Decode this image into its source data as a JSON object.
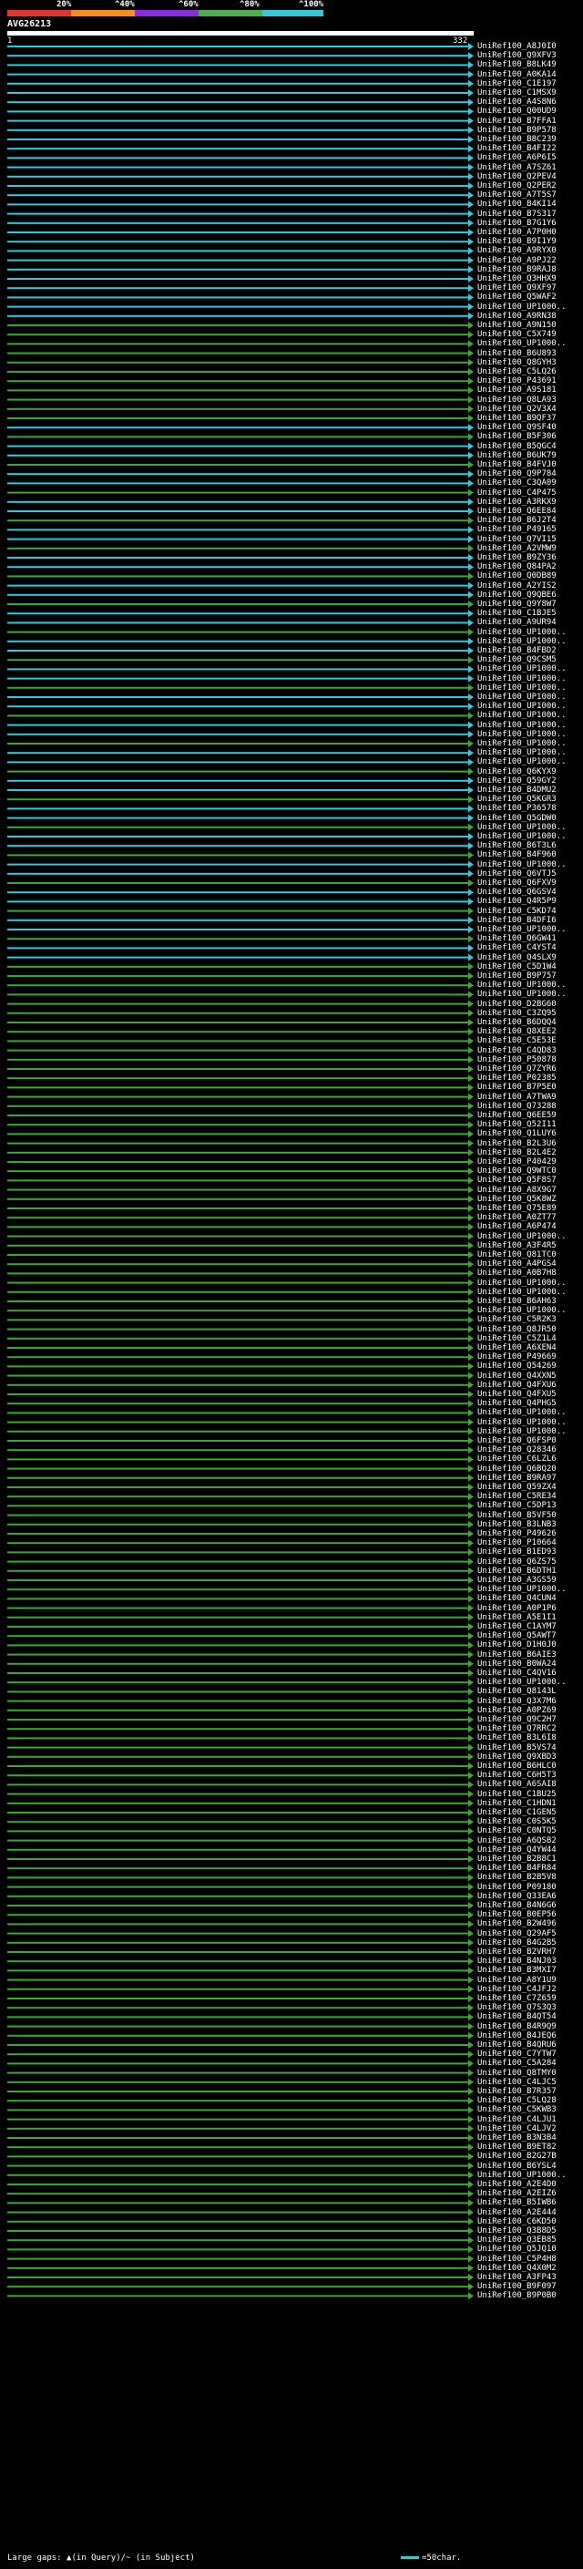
{
  "legend": {
    "ticks": [
      "20%",
      "^40%",
      "^60%",
      "^80%",
      "^100%"
    ],
    "colors": [
      "#e5352b",
      "#ff8c1a",
      "#8a2be2",
      "#4caf50",
      "#33c9dd"
    ]
  },
  "query": {
    "id": "AVG26213",
    "length_start": "1",
    "length_end": "332"
  },
  "hits": {
    "identity_colors": {
      "cyan": "#33c9dd",
      "green": "#3fa535"
    },
    "labels": [
      "UniRef100_A8J0I0",
      "UniRef100_Q9XFV3",
      "UniRef100_B8LK49",
      "UniRef100_A0KA14",
      "UniRef100_C1E197",
      "UniRef100_C1MSX9",
      "UniRef100_A4S8N6",
      "UniRef100_Q00UD9",
      "UniRef100_B7FFA1",
      "UniRef100_B9P578",
      "UniRef100_B8C239",
      "UniRef100_B4FI22",
      "UniRef100_A6P6I5",
      "UniRef100_A7SZ61",
      "UniRef100_Q2PEV4",
      "UniRef100_Q2PER2",
      "UniRef100_A7T5S7",
      "UniRef100_B4KI14",
      "UniRef100_B7S317",
      "UniRef100_B7G1Y6",
      "UniRef100_A7P0H0",
      "UniRef100_B9I1Y9",
      "UniRef100_A9RYX0",
      "UniRef100_A9PJ22",
      "UniRef100_B9RAJ8",
      "UniRef100_Q3HHX9",
      "UniRef100_Q9XF97",
      "UniRef100_Q5WAF2",
      "UniRef100_UP1000..",
      "UniRef100_A9RN38",
      "UniRef100_A9N150",
      "UniRef100_C5X749",
      "UniRef100_UP1000..",
      "UniRef100_B6U893",
      "UniRef100_Q8GYH3",
      "UniRef100_C5LQ26",
      "UniRef100_P43691",
      "UniRef100_A9S181",
      "UniRef100_Q8LA93",
      "UniRef100_Q2V3X4",
      "UniRef100_B9QF37",
      "UniRef100_Q9SF40",
      "UniRef100_B5F306",
      "UniRef100_B5QGC4",
      "UniRef100_B6UK79",
      "UniRef100_B4FVJ0",
      "UniRef100_Q9P784",
      "UniRef100_C3QA09",
      "UniRef100_C4P475",
      "UniRef100_A3RKX9",
      "UniRef100_Q6EE84",
      "UniRef100_B6J2T4",
      "UniRef100_P49165",
      "UniRef100_Q7VI15",
      "UniRef100_A2VMW9",
      "UniRef100_B9ZY36",
      "UniRef100_Q84PA2",
      "UniRef100_Q0DB89",
      "UniRef100_A2YIS2",
      "UniRef100_Q9QBE6",
      "UniRef100_Q9Y8W7",
      "UniRef100_C1BJE5",
      "UniRef100_A9UR94",
      "UniRef100_UP1000..",
      "UniRef100_UP1000..",
      "UniRef100_B4FBD2",
      "UniRef100_Q9CSM5",
      "UniRef100_UP1000..",
      "UniRef100_UP1000..",
      "UniRef100_UP1000..",
      "UniRef100_UP1000..",
      "UniRef100_UP1000..",
      "UniRef100_UP1000..",
      "UniRef100_UP1000..",
      "UniRef100_UP1000..",
      "UniRef100_UP1000..",
      "UniRef100_UP1000..",
      "UniRef100_UP1000..",
      "UniRef100_Q6KYX9",
      "UniRef100_Q59GY2",
      "UniRef100_B4DMU2",
      "UniRef100_Q5KGR3",
      "UniRef100_P36578",
      "UniRef100_Q5GDW0",
      "UniRef100_UP1000..",
      "UniRef100_UP1000..",
      "UniRef100_B6T3L6",
      "UniRef100_B4F960",
      "UniRef100_UP1000..",
      "UniRef100_Q6VTJ5",
      "UniRef100_Q6FXV9",
      "UniRef100_Q6GSV4",
      "UniRef100_Q4R5P9",
      "UniRef100_C5KD74",
      "UniRef100_B4DFI6",
      "UniRef100_UP1000..",
      "UniRef100_Q6GW41",
      "UniRef100_C4YST4",
      "UniRef100_Q4SLX9",
      "UniRef100_C5D1W4",
      "UniRef100_B9P757",
      "UniRef100_UP1000..",
      "UniRef100_UP1000..",
      "UniRef100_D2BG60",
      "UniRef100_C3ZQ95",
      "UniRef100_B6DQQ4",
      "UniRef100_Q8XEE2",
      "UniRef100_C5E53E",
      "UniRef100_C4QD83",
      "UniRef100_P50878",
      "UniRef100_Q7ZYR6",
      "UniRef100_P02385",
      "UniRef100_B7P5E0",
      "UniRef100_A7TWA9",
      "UniRef100_Q73288",
      "UniRef100_Q6EE59",
      "UniRef100_Q52I11",
      "UniRef100_Q1LUY6",
      "UniRef100_B2L3U6",
      "UniRef100_B2L4E2",
      "UniRef100_P40429",
      "UniRef100_Q9WTC0",
      "UniRef100_Q5F8S7",
      "UniRef100_A8X9G7",
      "UniRef100_Q5K8WZ",
      "UniRef100_Q75E89",
      "UniRef100_A0ZT77",
      "UniRef100_A6P474",
      "UniRef100_UP1000..",
      "UniRef100_A3F4R5",
      "UniRef100_Q81TC0",
      "UniRef100_A4PGS4",
      "UniRef100_A0B7H8",
      "UniRef100_UP1000..",
      "UniRef100_UP1000..",
      "UniRef100_B6AH63",
      "UniRef100_UP1000..",
      "UniRef100_C5R2K3",
      "UniRef100_Q8JR50",
      "UniRef100_C5Z1L4",
      "UniRef100_A6XEN4",
      "UniRef100_P49669",
      "UniRef100_Q54269",
      "UniRef100_Q4XXN5",
      "UniRef100_Q4FXU6",
      "UniRef100_Q4FXU5",
      "UniRef100_Q4PHG5",
      "UniRef100_UP1000..",
      "UniRef100_UP1000..",
      "UniRef100_UP1000..",
      "UniRef100_Q6FSP0",
      "UniRef100_Q28346",
      "UniRef100_C6LZL6",
      "UniRef100_Q6BQ20",
      "UniRef100_B9RA97",
      "UniRef100_Q59ZX4",
      "UniRef100_C5RE34",
      "UniRef100_C5DP13",
      "UniRef100_B5VF50",
      "UniRef100_B3LNB3",
      "UniRef100_P49626",
      "UniRef100_P10664",
      "UniRef100_B1ED93",
      "UniRef100_Q6ZS75",
      "UniRef100_B6DTH1",
      "UniRef100_A3GS59",
      "UniRef100_UP1000..",
      "UniRef100_Q4CUN4",
      "UniRef100_A0P1P6",
      "UniRef100_A5E1I1",
      "UniRef100_C1AYM7",
      "UniRef100_Q5AWT7",
      "UniRef100_D1H0J0",
      "UniRef100_B6AIE3",
      "UniRef100_B0WA24",
      "UniRef100_C4QV16",
      "UniRef100_UP1000..",
      "UniRef100_Q8143L",
      "UniRef100_Q3X7M6",
      "UniRef100_A0PZ69",
      "UniRef100_Q9C2H7",
      "UniRef100_Q7RRC2",
      "UniRef100_B3L6I8",
      "UniRef100_B5VS74",
      "UniRef100_Q9XBD3",
      "UniRef100_B6HLC0",
      "UniRef100_C6H5T3",
      "UniRef100_A6SAI8",
      "UniRef100_C1BU25",
      "UniRef100_C1HDN1",
      "UniRef100_C1GEN5",
      "UniRef100_C0S5K5",
      "UniRef100_C0NTQ5",
      "UniRef100_A6QSB2",
      "UniRef100_Q4YW44",
      "UniRef100_B2B8C1",
      "UniRef100_B4FR84",
      "UniRef100_B2B5V8",
      "UniRef100_P09180",
      "UniRef100_Q33EA6",
      "UniRef100_B4N6G6",
      "UniRef100_B0EP56",
      "UniRef100_B2W496",
      "UniRef100_Q29AF5",
      "UniRef100_B4G2B5",
      "UniRef100_B2VRH7",
      "UniRef100_B4NJ03",
      "UniRef100_B3MXI7",
      "UniRef100_A8Y1U9",
      "UniRef100_C4JFJ2",
      "UniRef100_C7Z659",
      "UniRef100_Q7S3Q3",
      "UniRef100_B4QT54",
      "UniRef100_B4R9Q9",
      "UniRef100_B4JEQ6",
      "UniRef100_B4QRU6",
      "UniRef100_C7YTW7",
      "UniRef100_C5A284",
      "UniRef100_Q8TMY0",
      "UniRef100_C4LJC5",
      "UniRef100_B7R357",
      "UniRef100_C5LQ28",
      "UniRef100_C5KWB3",
      "UniRef100_C4LJU1",
      "UniRef100_C4LJV2",
      "UniRef100_B3N3B4",
      "UniRef100_B9ET82",
      "UniRef100_B2G27B",
      "UniRef100_B6YSL4",
      "UniRef100_UP1000..",
      "UniRef100_A2E4D0",
      "UniRef100_A2EIZ6",
      "UniRef100_B5IWB6",
      "UniRef100_A2E444",
      "UniRef100_C6KD50",
      "UniRef100_Q3B8D5",
      "UniRef100_Q3EB85",
      "UniRef100_Q5JQ10",
      "UniRef100_C5P4H8",
      "UniRef100_Q4X0M2",
      "UniRef100_A3FP43",
      "UniRef100_B9F097",
      "UniRef100_B9P0B0"
    ]
  },
  "footer": {
    "gaps_label": "Large gaps: ▲(in Query)/~ (in Subject)",
    "scale_label": "=50char."
  }
}
